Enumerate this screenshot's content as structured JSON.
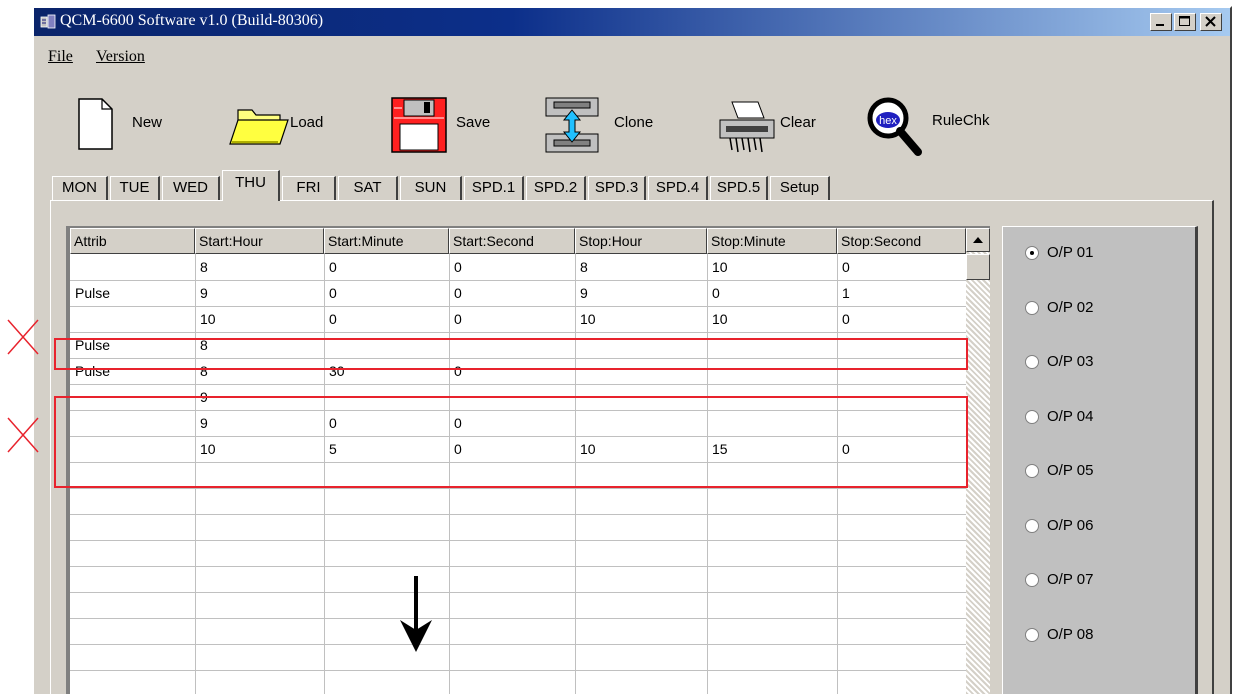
{
  "window": {
    "title": "QCM-6600 Software v1.0 (Build-80306)"
  },
  "menu": {
    "file": "File",
    "version": "Version"
  },
  "toolbar": {
    "new": "New",
    "load": "Load",
    "save": "Save",
    "clone": "Clone",
    "clear": "Clear",
    "rulechk": "RuleChk",
    "rulechk_icon_text": "hex"
  },
  "tabs": [
    "MON",
    "TUE",
    "WED",
    "THU",
    "FRI",
    "SAT",
    "SUN",
    "SPD.1",
    "SPD.2",
    "SPD.3",
    "SPD.4",
    "SPD.5",
    "Setup"
  ],
  "active_tab": "THU",
  "grid": {
    "columns": [
      "Attrib",
      "Start:Hour",
      "Start:Minute",
      "Start:Second",
      "Stop:Hour",
      "Stop:Minute",
      "Stop:Second"
    ],
    "rows": [
      [
        "",
        "8",
        "0",
        "0",
        "8",
        "10",
        "0"
      ],
      [
        "Pulse",
        "9",
        "0",
        "0",
        "9",
        "0",
        "1"
      ],
      [
        "",
        "10",
        "0",
        "0",
        "10",
        "10",
        "0"
      ],
      [
        "Pulse",
        "8",
        "",
        "",
        "",
        "",
        ""
      ],
      [
        "Pulse",
        "8",
        "30",
        "0",
        "",
        "",
        ""
      ],
      [
        "",
        "9",
        "",
        "",
        "",
        "",
        ""
      ],
      [
        "",
        "9",
        "0",
        "0",
        "",
        "",
        ""
      ],
      [
        "",
        "10",
        "5",
        "0",
        "10",
        "15",
        "0"
      ]
    ]
  },
  "outputs": {
    "items": [
      "O/P 01",
      "O/P 02",
      "O/P 03",
      "O/P 04",
      "O/P 05",
      "O/P 06",
      "O/P 07",
      "O/P 08"
    ],
    "selected": "O/P 01"
  },
  "annotation_color": "#e8232d"
}
